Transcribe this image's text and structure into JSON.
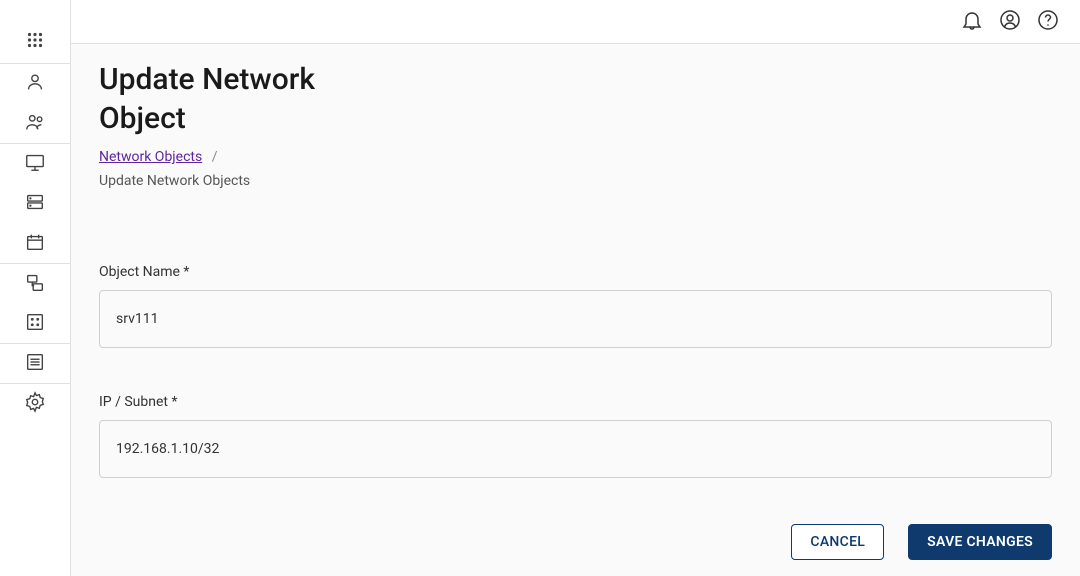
{
  "header": {
    "title": "Update Network Object"
  },
  "breadcrumb": {
    "link": "Network Objects",
    "separator": "/",
    "current": "Update Network Objects"
  },
  "form": {
    "object_name": {
      "label": "Object Name *",
      "value": "srv111"
    },
    "ip_subnet": {
      "label": "IP / Subnet *",
      "value": "192.168.1.10/32"
    }
  },
  "buttons": {
    "cancel": "CANCEL",
    "save": "SAVE CHANGES"
  },
  "sidebar": {
    "items": [
      "apps",
      "person",
      "group",
      "monitor",
      "server",
      "calendar",
      "cloud-link",
      "analytics",
      "list",
      "settings"
    ]
  },
  "topbar": {
    "items": [
      "notifications",
      "account",
      "help"
    ]
  }
}
